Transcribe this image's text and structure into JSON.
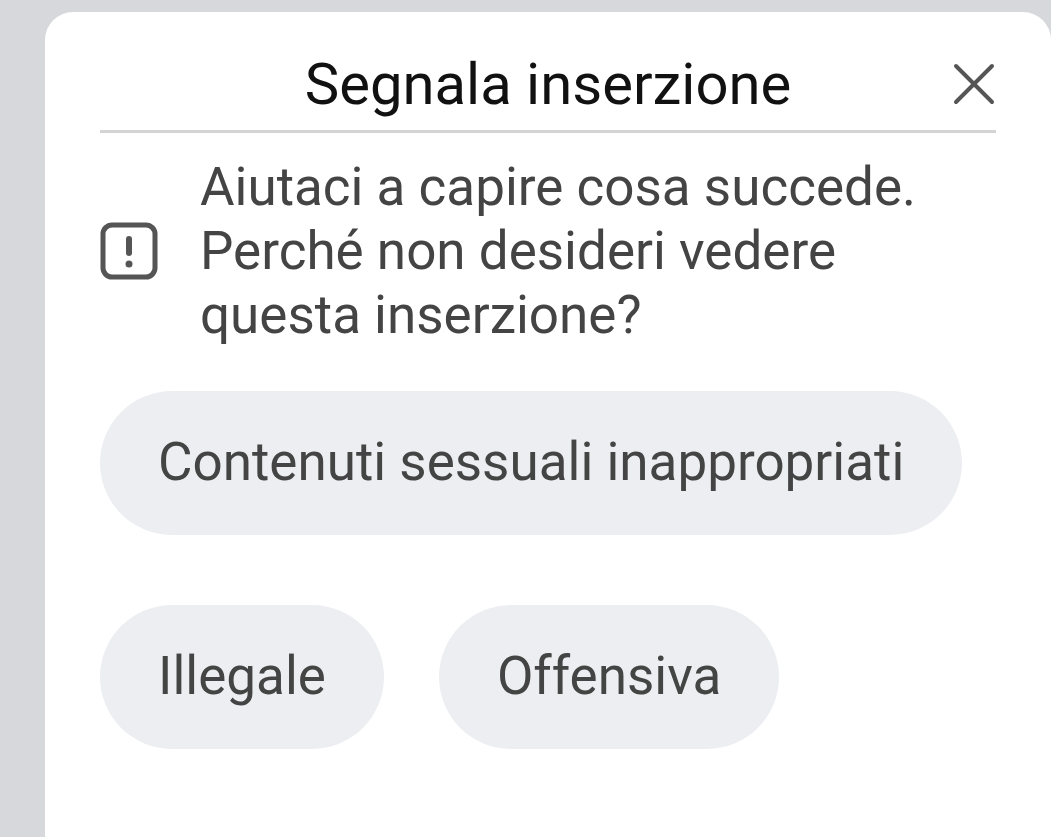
{
  "dialog": {
    "title": "Segnala inserzione",
    "message": "Aiutaci a capire cosa succede. Perché non desideri vedere questa inserzione?",
    "options": [
      {
        "label": "Contenuti sessuali inappropriati"
      },
      {
        "label": "Illegale"
      },
      {
        "label": "Offensiva"
      }
    ]
  }
}
